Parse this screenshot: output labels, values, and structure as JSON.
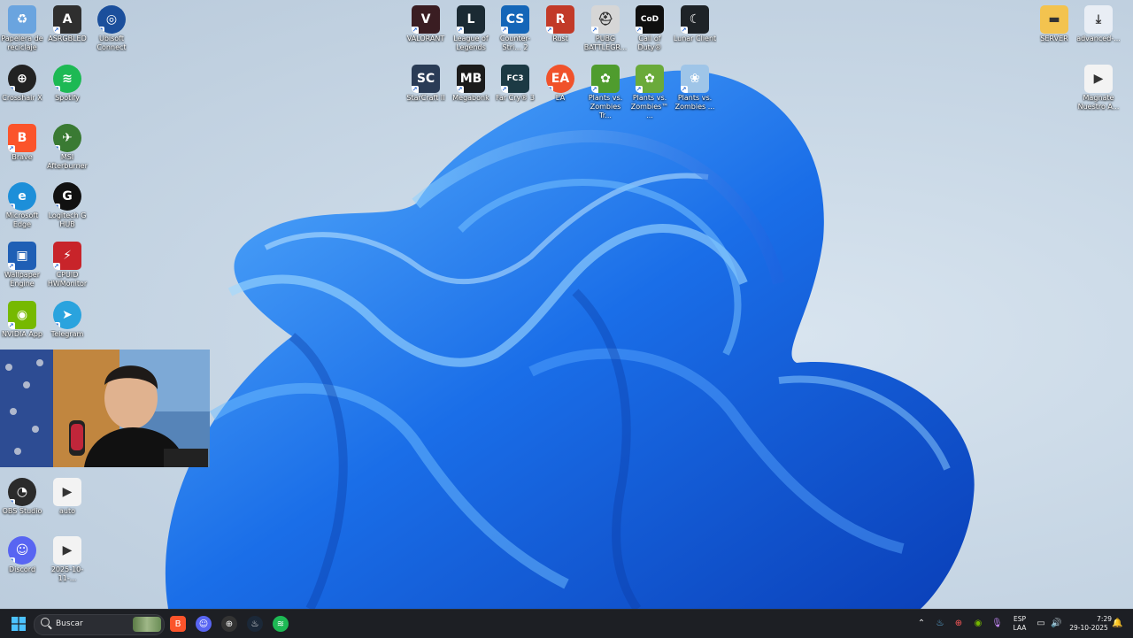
{
  "desktop": {
    "icons": [
      {
        "id": "recycle",
        "label": "Papelera de reciclaje",
        "icon": "recycle-bin-icon",
        "color": "#6aa4df",
        "glyph": "♻"
      },
      {
        "id": "asrgbled",
        "label": "ASRGBLED",
        "icon": "asrock-rgb-icon",
        "color": "#2f2f2f",
        "glyph": "A"
      },
      {
        "id": "ubisoft",
        "label": "Ubisoft Connect",
        "icon": "ubisoft-icon",
        "color": "#1b4f9c",
        "glyph": "◎"
      },
      {
        "id": "crosshair",
        "label": "Crosshair X",
        "icon": "crosshair-icon",
        "color": "#222222",
        "glyph": "⊕"
      },
      {
        "id": "spotify",
        "label": "Spotify",
        "icon": "spotify-icon",
        "color": "#1db954",
        "glyph": "≋"
      },
      {
        "id": "brave",
        "label": "Brave",
        "icon": "brave-lion-icon",
        "color": "#fb542b",
        "glyph": "B"
      },
      {
        "id": "afterburner",
        "label": "MSI Afterburner",
        "icon": "msi-afterburner-icon",
        "color": "#3a7a33",
        "glyph": "✈"
      },
      {
        "id": "edge",
        "label": "Microsoft Edge",
        "icon": "edge-icon",
        "color": "#1d8fd9",
        "glyph": "e"
      },
      {
        "id": "ghub",
        "label": "Logitech G HUB",
        "icon": "logitech-g-icon",
        "color": "#111111",
        "glyph": "G"
      },
      {
        "id": "wallpaper",
        "label": "Wallpaper Engine",
        "icon": "wallpaper-engine-icon",
        "color": "#1f5fb5",
        "glyph": "▣"
      },
      {
        "id": "gpuid",
        "label": "CPUID HWMonitor",
        "icon": "hwmonitor-icon",
        "color": "#c8242a",
        "glyph": "⚡"
      },
      {
        "id": "nvidia",
        "label": "NVIDIA App",
        "icon": "nvidia-icon",
        "color": "#76b900",
        "glyph": "◉"
      },
      {
        "id": "telegram",
        "label": "Telegram",
        "icon": "telegram-icon",
        "color": "#2aa3de",
        "glyph": "➤"
      },
      {
        "id": "obs",
        "label": "OBS Studio",
        "icon": "obs-icon",
        "color": "#2b2b2b",
        "glyph": "◔"
      },
      {
        "id": "auto",
        "label": "auto",
        "icon": "video-file-icon",
        "color": "#f3f3f3",
        "glyph": "▶"
      },
      {
        "id": "discord",
        "label": "Discord",
        "icon": "discord-icon",
        "color": "#5865f2",
        "glyph": "☺"
      },
      {
        "id": "video2025",
        "label": "2025-10-11-...",
        "icon": "video-file-icon",
        "color": "#f3f3f3",
        "glyph": "▶"
      },
      {
        "id": "valorant",
        "label": "VALORANT",
        "icon": "valorant-icon",
        "color": "#3a1d22",
        "glyph": "V"
      },
      {
        "id": "lol",
        "label": "League of Legends",
        "icon": "league-of-legends-icon",
        "color": "#1b2a33",
        "glyph": "L"
      },
      {
        "id": "cs2",
        "label": "Counter-Stri... 2",
        "icon": "counter-strike-icon",
        "color": "#1466b8",
        "glyph": "CS"
      },
      {
        "id": "rust",
        "label": "Rust",
        "icon": "rust-icon",
        "color": "#c23a28",
        "glyph": "R"
      },
      {
        "id": "pubg",
        "label": "PUBG BATTLEGR...",
        "icon": "pubg-helmet-icon",
        "color": "#d6d6d6",
        "glyph": "⛑"
      },
      {
        "id": "cod",
        "label": "Call of Duty®",
        "icon": "call-of-duty-icon",
        "color": "#0f0f0f",
        "glyph": "CoD"
      },
      {
        "id": "lunar",
        "label": "Lunar Client",
        "icon": "lunar-client-icon",
        "color": "#1e2327",
        "glyph": "☾"
      },
      {
        "id": "starcraft",
        "label": "StarCraft II",
        "icon": "starcraft-icon",
        "color": "#2a3c56",
        "glyph": "SC"
      },
      {
        "id": "megabonk",
        "label": "Megabonk",
        "icon": "megabonk-icon",
        "color": "#1b1b1b",
        "glyph": "MB"
      },
      {
        "id": "farcry",
        "label": "Far Cry® 3",
        "icon": "far-cry-3-icon",
        "color": "#1c3a44",
        "glyph": "FC3"
      },
      {
        "id": "ea",
        "label": "EA",
        "icon": "ea-icon",
        "color": "#f0522b",
        "glyph": "EA"
      },
      {
        "id": "pvz1",
        "label": "Plants vs. Zombies Tr...",
        "icon": "pvz-icon",
        "color": "#4f9c2e",
        "glyph": "✿"
      },
      {
        "id": "pvz2",
        "label": "Plants vs. Zombies™ ...",
        "icon": "pvz-icon",
        "color": "#6aaa3a",
        "glyph": "✿"
      },
      {
        "id": "pvz3",
        "label": "Plants vs. Zombies ...",
        "icon": "pvz-flower-icon",
        "color": "#9fc5e8",
        "glyph": "❀"
      },
      {
        "id": "server",
        "label": "SERVER",
        "icon": "folder-icon",
        "color": "#f3c34f",
        "glyph": "▬"
      },
      {
        "id": "advanced",
        "label": "advanced-...",
        "icon": "download-icon",
        "color": "#e9eef5",
        "glyph": "⤓"
      },
      {
        "id": "magnate",
        "label": "Magnate Nuestro A...",
        "icon": "video-file-icon",
        "color": "#f3f3f3",
        "glyph": "▶"
      }
    ]
  },
  "taskbar": {
    "search_placeholder": "Buscar",
    "apps": [
      {
        "id": "start",
        "icon": "windows-start-icon"
      },
      {
        "id": "brave",
        "icon": "brave-lion-icon",
        "color": "#fb542b",
        "glyph": "B"
      },
      {
        "id": "discord",
        "icon": "discord-icon",
        "color": "#5865f2",
        "glyph": "☺"
      },
      {
        "id": "crosshair",
        "icon": "crosshair-icon",
        "color": "#333333",
        "glyph": "⊕"
      },
      {
        "id": "steam",
        "icon": "steam-icon",
        "color": "#1b2838",
        "glyph": "♨"
      },
      {
        "id": "spotify",
        "icon": "spotify-icon",
        "color": "#1db954",
        "glyph": "≋"
      }
    ],
    "tray": {
      "language": "ESP",
      "layout": "LAA",
      "time": "7:29",
      "date": "29-10-2025"
    }
  }
}
